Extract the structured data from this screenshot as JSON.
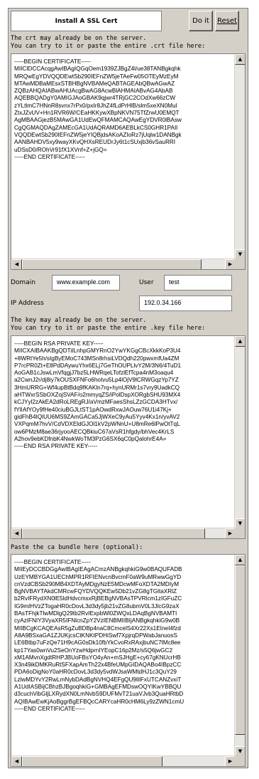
{
  "header": {
    "title": "Install A SSL Cert",
    "doit_label": "Do it",
    "reset_label": "Reset"
  },
  "crt": {
    "hint": "The crt may already be on the server.\nYou can try to it or paste the entire .crt file here:",
    "value": "-----BEGIN CERTIFICATE-----\nMIICIDCCAcqgAwIBAgIQGqOem1939ZJBgZ4l/ue38TANBgkqhk\nMRQwEgYDVQQDEwtSb290IEFnZW5jeTAeFw05OTEyMzEyM\nMTAwMDBaMEsxSTBHBgNVBAMeQABTAGEAbQBwAGwAZ\nZQBzAHQAIABwAHUAcgBwAG8AcwBlAHMAIABvAG4AbAB\nAQEBBQADgY0AMIGJAoGBAK9qjwr4TRjGC2COdXw66zCW\nzYLtlmC7HNnR8svnx7rPx0/pxIr8JhZ4fLdPrHlB/slm5xeXN0Mul\nZtxJZvUV+Hn1RVR6W/CEaHKKywXBpNKVN75TfZrwU0EMQT\nAgMBAAGjezB5MAwGA1UdEwQFMAMCAQAwEgYDVR0lBAsw\nCgQGMAQDAgZAMEcGA1UdAQRAMD6AEBLkCS0GHR1PAIl\nVQQDEwtSb290IEFnZW5jeYIQBjdsAKoAZIoRz7jUqlw1DANBgk\nAANBAHDV5xy9wayXKvQHXsREUDrJy6t1cSUxjb36vSauRRI\nuDSsD0/ROhVr91fX1XVnf+Z+jGQ=\n-----END CERTIFICATE-----"
  },
  "domain": {
    "label": "Domain",
    "value": "www.example.com"
  },
  "user": {
    "label": "User",
    "value": "test"
  },
  "ip": {
    "label": "IP Address",
    "value": "192.0.34.166"
  },
  "key": {
    "hint": "The key may already be on the server.\nYou can try to it or paste the entire .key file here:",
    "value": "-----BEGIN RSA PRIVATE KEY-----\nMIICXAIBAAKBgQDTiILnhpGMYRnO2YwYKGgCBcXkkKoP3U4\n+8WRtYe5h/sIgByEMoC743MSn8rhsiLVDQdh220pwxmfUa4ZM\nP7rcPR0Zt+E8PdDAywuYhx6ELj7GeThOUPLlvY2M/3N6/4TuD1\nAoGAB1cJswLmVfqgjJ7bz5LHWRqeLTofzlEfTcpa4nM3oaqu4\na2CwnJ2r/dj8iy7kOUSXFNFo6hoIvu5Lp4lOjV9lCRWGqzYp7YZ\n3HmURRG+Wf4upBtBdq9fKAKln7rq+hynURMr1s7vry9UadkCQ\naHTWxrSSbOXZojSVAF/o2mmyqZS/iPolDspXORgbSHU93MX4\nkCJYyl2zAkEA2dRoLREgRJ/aVmzMFaesShsLZzGCDA3HTvx/\nfYlIAfYOy9fHe40ciuBGJLtST1pAOwdRxwJAOuw76U1i47Kj+\ngidFhB4IQlUU6MS9ZAmGACa5JjWXeC9yAu5Yyv4Kx1n/yvAV2\nVXPqmM7hvV/CdVDXEldGJOl1kV2pWNnU+U8mRe6lPwOtTqL\now6PMzM8ae36rjyooAECQBkiuC67aVsR1hfgdy/bhVec4KrLS\nA2hov9ebKDfnbK4NwkWoTM3PzG6SX6qC0pQalohrE4A=\n-----END RSA PRIVATE KEY-----"
  },
  "ca": {
    "hint": "Paste the ca bundle here (optional):",
    "value": "-----BEGIN CERTIFICATE-----\nMIIEyDCCBDGgAwIBAgIEAgACmzANBgkqhkiG9w0BAQUFADB\nUzEYMBYGA1UEChMPR1RFIENvcnBvcmF0aW9uMRwwGgYD\ncnVzdCBSb290MB4XDTAyMDgyNzE5MDcwMFoXDTA2MDIyM\nBgNVBAYTAkdCMRcwFQYDVQQKEw5Db21vZG8gTGltaXRlZ\nb2RvIFRydXN0lE5ldHdvcmsxRjBEBgNVBAsTPVRlcm1zIGFuZC\nIG9mIHVzZTogaHR0cDovL3d3dy5jb21vZG8ubmV0L3JlcG9zaX\nBAsTFhjkTlwMDlgQ29tb2RvIExpbWl0ZWQxLDAqBgNVBAMTI\ncyAzIFNIY3VyaXR5IFNlcnZpY2VzIENBMIIBIjANBgkqhkiG9w0B\nMIIBCgKCAQEAsR5gZuBDBp4naC8CmcelS4Xr22Xs1EIneI4fzd\nA8A9BSxaGA1ZJUKjcsCtKNKtPDHiSwf7XpjrqDPWabJanuosS\nLE6Btbp7uFzQe71H9cAG0sDk10fbYkCvoRxRAxjbuNC7IMc8ee\nkp17Yas0wnVu2SeOnYzwHdprnIYEopC16p2Mz/s5Q6jwGC2\nxM1AMvnXgdtRHPJBUoFBsYO4yAn+mSJHgE+cy67gKNUcrHB\nX3n49ikDMKRuRtSFXapAmTh22x4BfeUMpGIDAQABo4IBpzCC\nPDA6oDigNoY0aHR0cDovL3d3dy5vdWJsaWMtdHJ1c3QuY29\nLzlwMDYvY2RwLmNybDAdBgNVHQ4EFgQU9lIlFxUTCANZvxiT\nA1UdIASBijCBhzBJBgoqhkiG+GMBAgEFMDswOQYIKwYBBQU\nd3cuchVibGljLXRydXN0LmNvbS9DUFMvT21uaVJvb3QuaHRtbD\nAQIBAwEwKjAoBggrBgEFBQcCARYcaHR0cHM6Ly9zZWN1cmU\n-----END CERTIFICATE-----"
  }
}
